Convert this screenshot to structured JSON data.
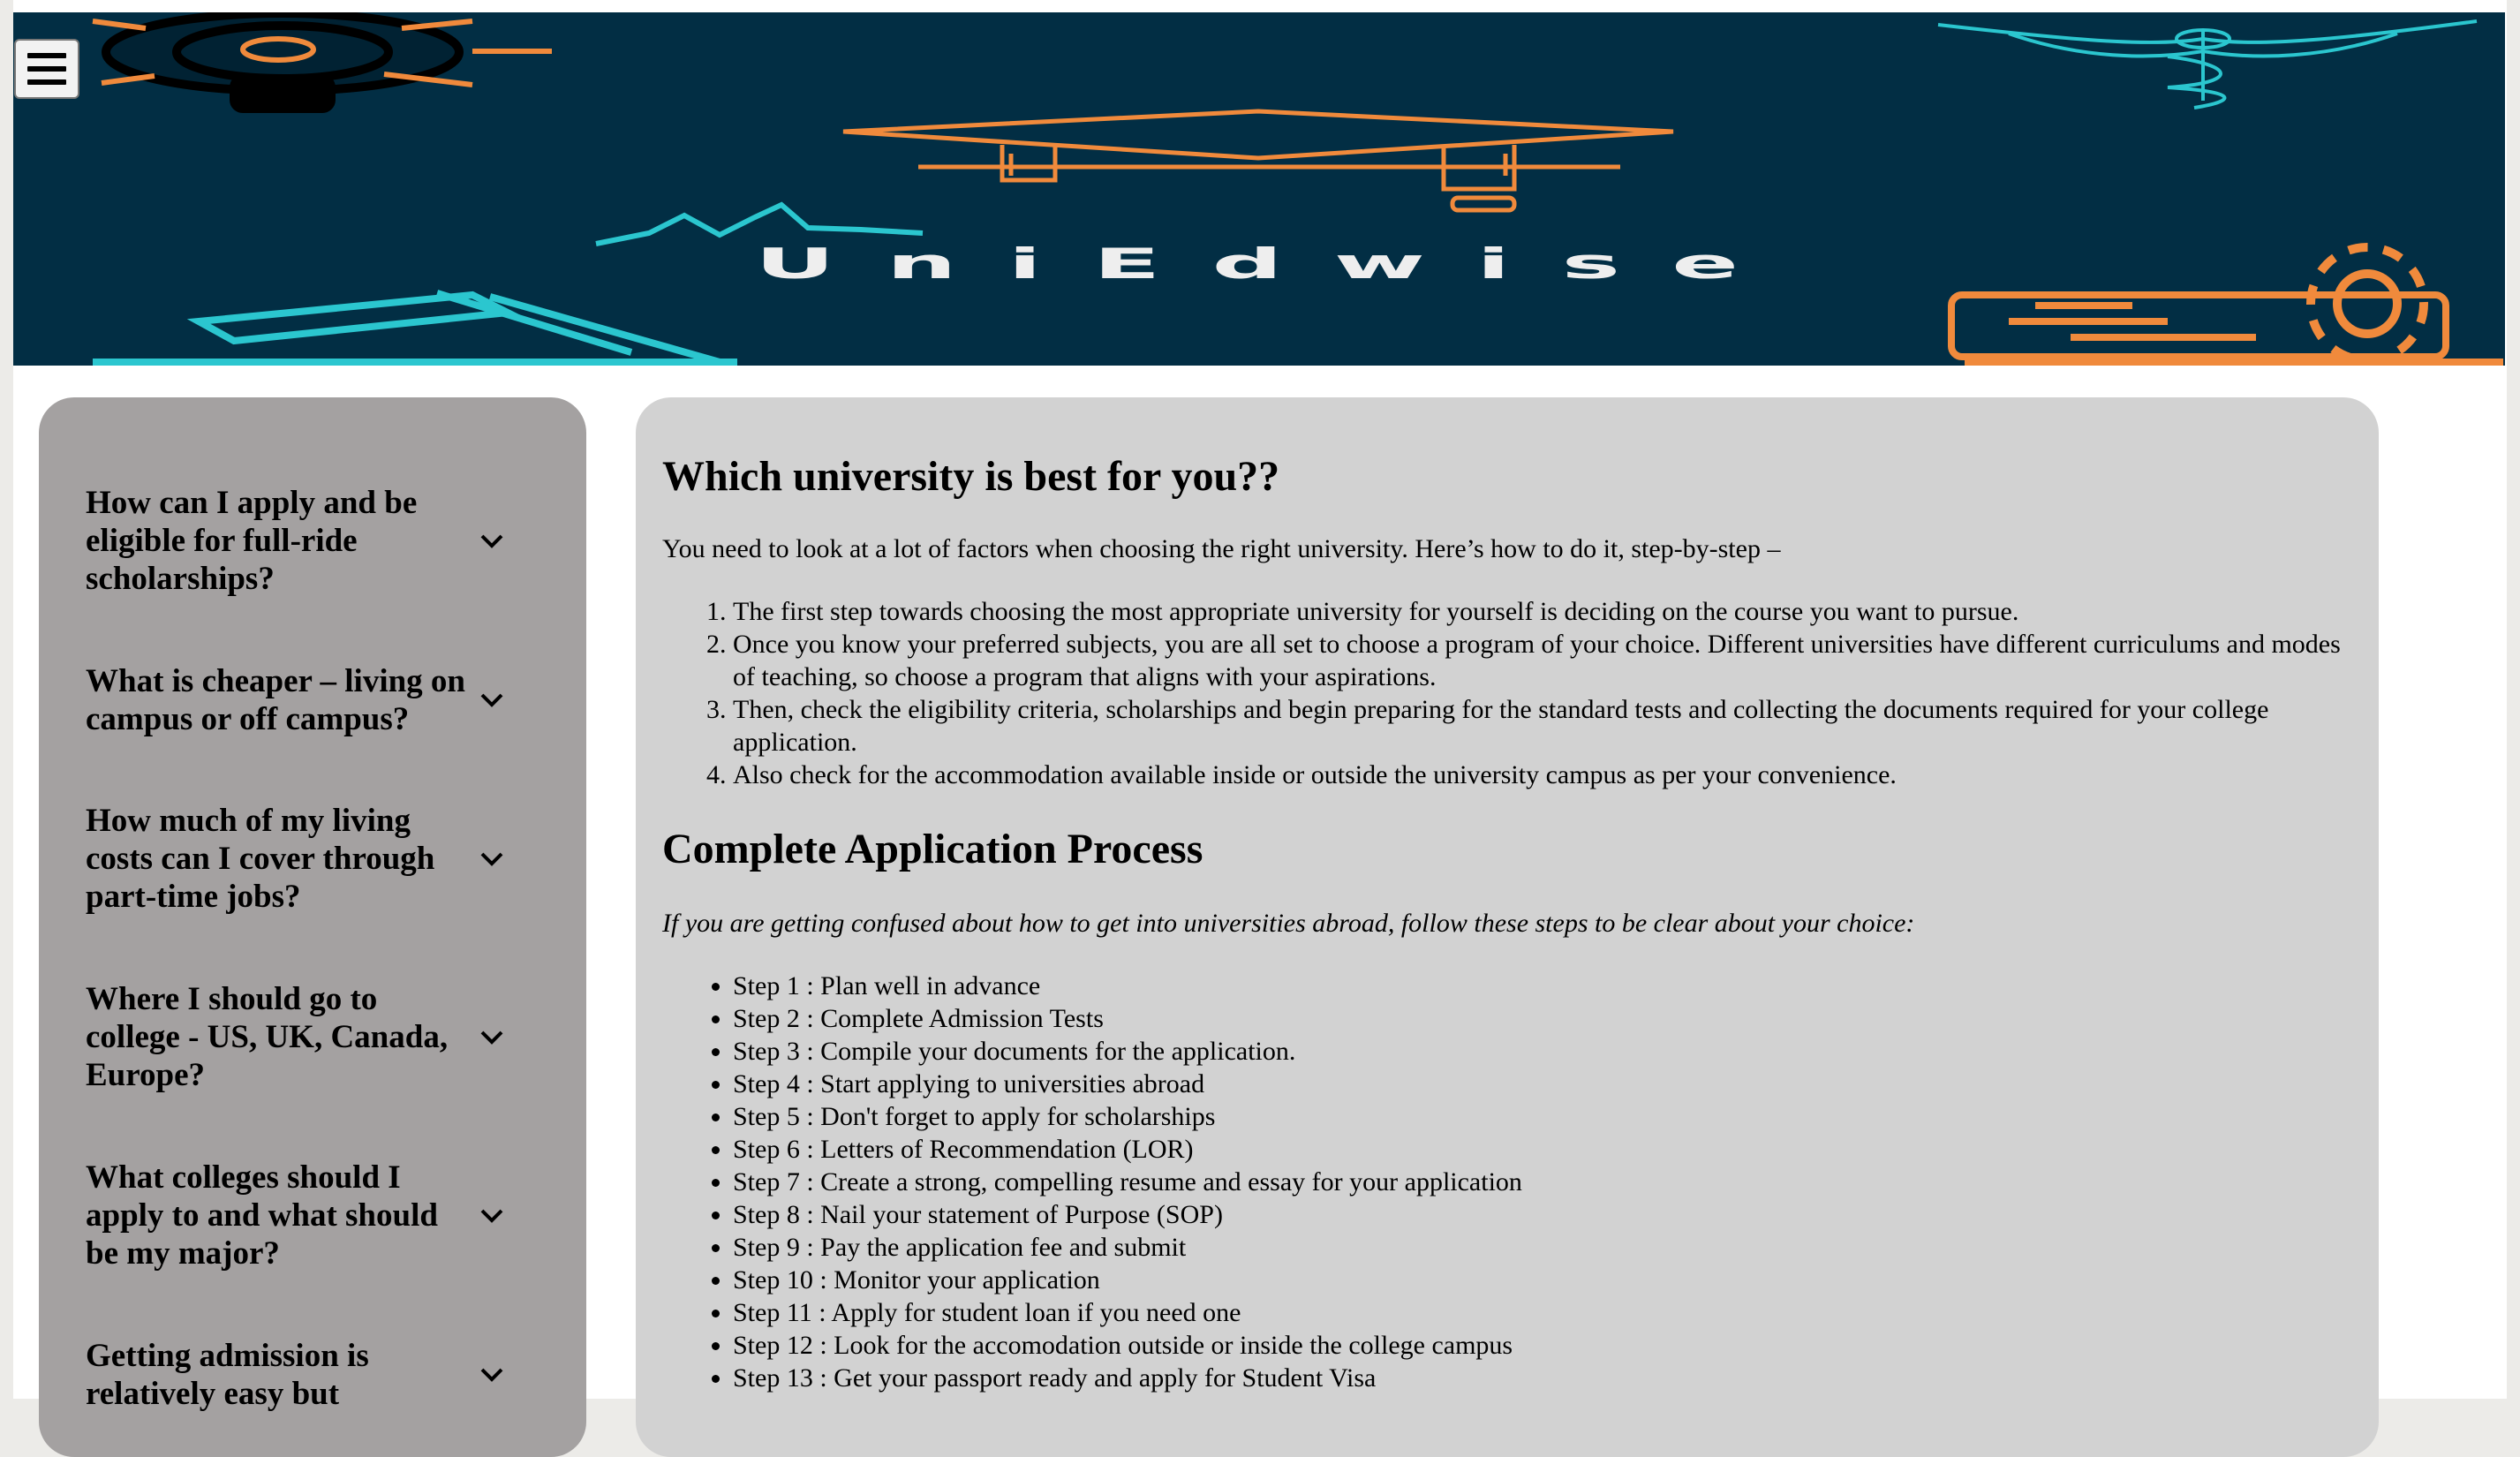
{
  "brand": {
    "title": "UniEdwise"
  },
  "menu": {
    "icon": "hamburger-icon"
  },
  "colors": {
    "banner": "#022e44",
    "accent_orange": "#f08a3c",
    "accent_teal": "#2bc6cf",
    "sidebar": "#a4a1a1",
    "main": "#d2d2d2"
  },
  "sidebar": {
    "items": [
      {
        "question": "How can I apply and be eligible for full-ride scholarships?",
        "icon": "chevron-down-icon"
      },
      {
        "question": "What is cheaper – living on campus or off campus?",
        "icon": "chevron-down-icon"
      },
      {
        "question": "How much of my living costs can I cover through part-time jobs?",
        "icon": "chevron-down-icon"
      },
      {
        "question": "Where I should go to college - US, UK, Canada, Europe?",
        "icon": "chevron-down-icon"
      },
      {
        "question": "What colleges should I apply to and what should be my major?",
        "icon": "chevron-down-icon"
      },
      {
        "question": "Getting admission is relatively easy but",
        "icon": "chevron-down-icon"
      }
    ]
  },
  "main": {
    "heading": "Which university is best for you??",
    "intro": "You need to look at a lot of factors when choosing the right university. Here’s how to do it, step-by-step –",
    "factors": [
      "The first step towards choosing the most appropriate university for yourself is deciding on the course you want to pursue.",
      "Once you know your preferred subjects, you are all set to choose a program of your choice. Different universities have different curriculums and modes of teaching, so choose a program that aligns with your aspirations.",
      "Then, check the eligibility criteria, scholarships and begin preparing for the standard tests and collecting the documents required for your college application.",
      "Also check for the accommodation available inside or outside the university campus as per your convenience."
    ],
    "process_heading": "Complete Application Process",
    "process_note": "If you are getting confused about how to get into universities abroad, follow these steps to be clear about your choice:",
    "steps": [
      "Step 1 : Plan well in advance",
      "Step 2 : Complete Admission Tests",
      "Step 3 : Compile your documents for the application.",
      "Step 4 : Start applying to universities abroad",
      "Step 5 : Don't forget to apply for scholarships",
      "Step 6 : Letters of Recommendation (LOR)",
      "Step 7 : Create a strong, compelling resume and essay for your application",
      "Step 8 : Nail your statement of Purpose (SOP)",
      "Step 9 : Pay the application fee and submit",
      "Step 10 : Monitor your application",
      "Step 11 : Apply for student loan if you need one",
      "Step 12 : Look for the accomodation outside or inside the college campus",
      "Step 13 : Get your passport ready and apply for Student Visa"
    ]
  }
}
